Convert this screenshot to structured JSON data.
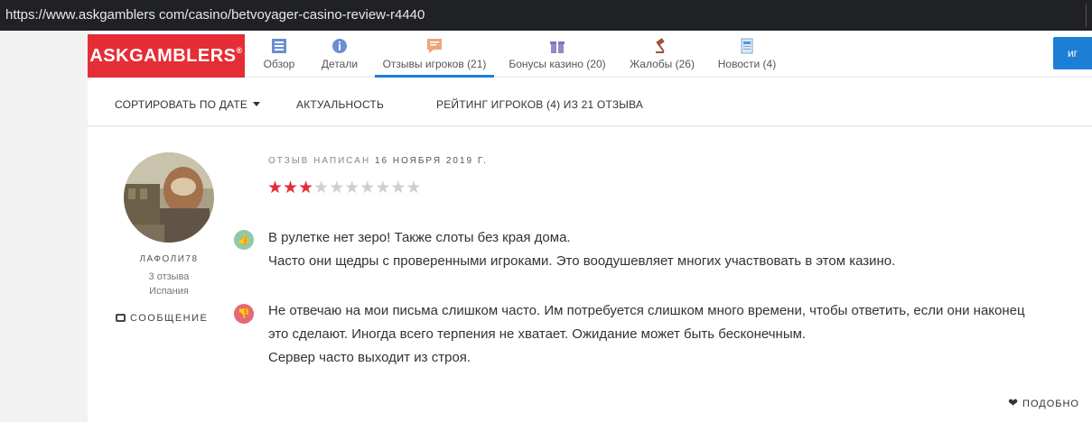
{
  "browser": {
    "url": "https://www.askgamblers com/casino/betvoyager-casino-review-r4440"
  },
  "logo": {
    "text": "ASKGAMBLERS",
    "mark": "®"
  },
  "tabs": [
    {
      "label": "Обзор",
      "icon": "list-icon"
    },
    {
      "label": "Детали",
      "icon": "info-icon"
    },
    {
      "label": "Отзывы игроков (21)",
      "icon": "chat-icon",
      "active": true
    },
    {
      "label": "Бонусы казино (20)",
      "icon": "gift-icon"
    },
    {
      "label": "Жалобы (26)",
      "icon": "gavel-icon"
    },
    {
      "label": "Новости (4)",
      "icon": "document-icon"
    }
  ],
  "header_button": {
    "label": "иг"
  },
  "sort": {
    "by_date": "СОРТИРОВАТЬ ПО ДАТЕ",
    "relevance": "АКТУАЛЬНОСТЬ",
    "rating": "РЕЙТИНГ ИГРОКОВ (4) ИЗ 21 ОТЗЫВА"
  },
  "review": {
    "written_label": "ОТЗЫВ НАПИСАН",
    "date": "16 НОЯБРЯ 2019 Г.",
    "rating": 3,
    "rating_max": 10,
    "user": {
      "name": "ЛАФОЛИ78",
      "reviews": "3 отзыва",
      "country": "Испания",
      "message_label": "СООБЩЕНИЕ"
    },
    "positive": [
      "В рулетке нет зеро! Также слоты без края дома.",
      "Часто они щедры с проверенными игроками. Это воодушевляет многих участвовать в этом казино."
    ],
    "negative": [
      "Не отвечаю на мои письма слишком часто. Им потребуется слишком много времени, чтобы ответить, если они наконец",
      "это сделают. Иногда всего терпения не хватает. Ожидание может быть бесконечным.",
      "Сервер часто выходит из строя."
    ],
    "like_label": "ПОДОБНО"
  },
  "colors": {
    "brand": "#e52d35",
    "accent": "#1d7ed6",
    "star_on": "#e52d35",
    "star_off": "#cfcfcf",
    "pro": "#8fc9a9",
    "con": "#e56a74"
  }
}
